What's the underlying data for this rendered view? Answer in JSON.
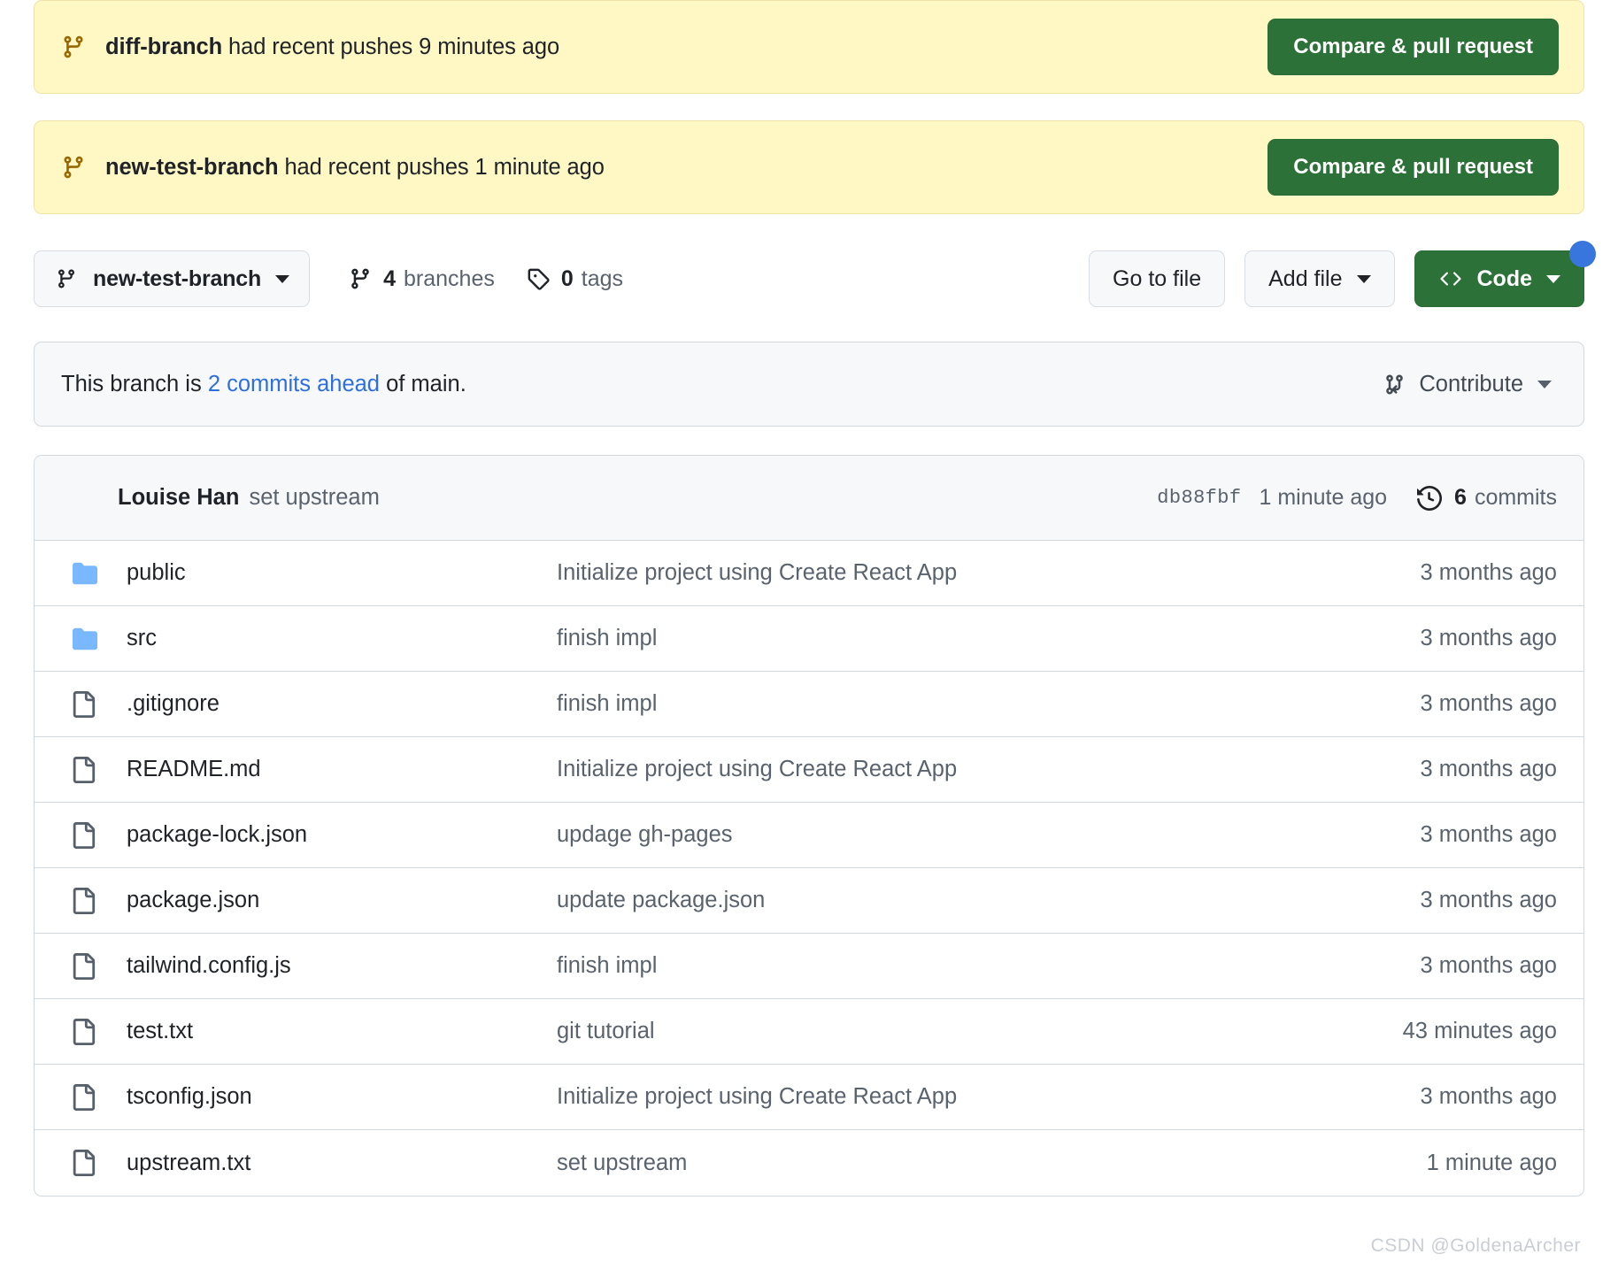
{
  "banners": [
    {
      "branch": "diff-branch",
      "suffix": " had recent pushes 9 minutes ago",
      "button": "Compare & pull request",
      "icon": "branch-icon",
      "accent": "#9a6700"
    },
    {
      "branch": "new-test-branch",
      "suffix": " had recent pushes 1 minute ago",
      "button": "Compare & pull request",
      "icon": "branch-icon",
      "accent": "#9a6700"
    }
  ],
  "toolbar": {
    "current_branch": "new-test-branch",
    "branches_count": "4",
    "branches_label": "branches",
    "tags_count": "0",
    "tags_label": "tags",
    "go_to_file": "Go to file",
    "add_file": "Add file",
    "code": "Code",
    "green": "#2c7138"
  },
  "branch_status": {
    "prefix": "This branch is ",
    "link": "2 commits ahead",
    "suffix": " of main.",
    "link_color": "#2f6fdd",
    "contribute": "Contribute"
  },
  "commit_header": {
    "author": "Louise Han",
    "message": "set upstream",
    "hash": "db88fbf",
    "date": "1 minute ago",
    "commits_count": "6",
    "commits_label": "commits"
  },
  "files": [
    {
      "type": "folder",
      "name": "public",
      "message": "Initialize project using Create React App",
      "time": "3 months ago"
    },
    {
      "type": "folder",
      "name": "src",
      "message": "finish impl",
      "time": "3 months ago"
    },
    {
      "type": "file",
      "name": ".gitignore",
      "message": "finish impl",
      "time": "3 months ago"
    },
    {
      "type": "file",
      "name": "README.md",
      "message": "Initialize project using Create React App",
      "time": "3 months ago"
    },
    {
      "type": "file",
      "name": "package-lock.json",
      "message": "updage gh-pages",
      "time": "3 months ago"
    },
    {
      "type": "file",
      "name": "package.json",
      "message": "update package.json",
      "time": "3 months ago"
    },
    {
      "type": "file",
      "name": "tailwind.config.js",
      "message": "finish impl",
      "time": "3 months ago"
    },
    {
      "type": "file",
      "name": "test.txt",
      "message": "git tutorial",
      "time": "43 minutes ago"
    },
    {
      "type": "file",
      "name": "tsconfig.json",
      "message": "Initialize project using Create React App",
      "time": "3 months ago"
    },
    {
      "type": "file",
      "name": "upstream.txt",
      "message": "set upstream",
      "time": "1 minute ago"
    }
  ],
  "watermark": "CSDN @GoldenaArcher",
  "colors": {
    "banner_bg": "#fff8c5",
    "folder_blue": "#79b8ff",
    "file_gray": "#57606a",
    "muted_text": "#59636e"
  }
}
